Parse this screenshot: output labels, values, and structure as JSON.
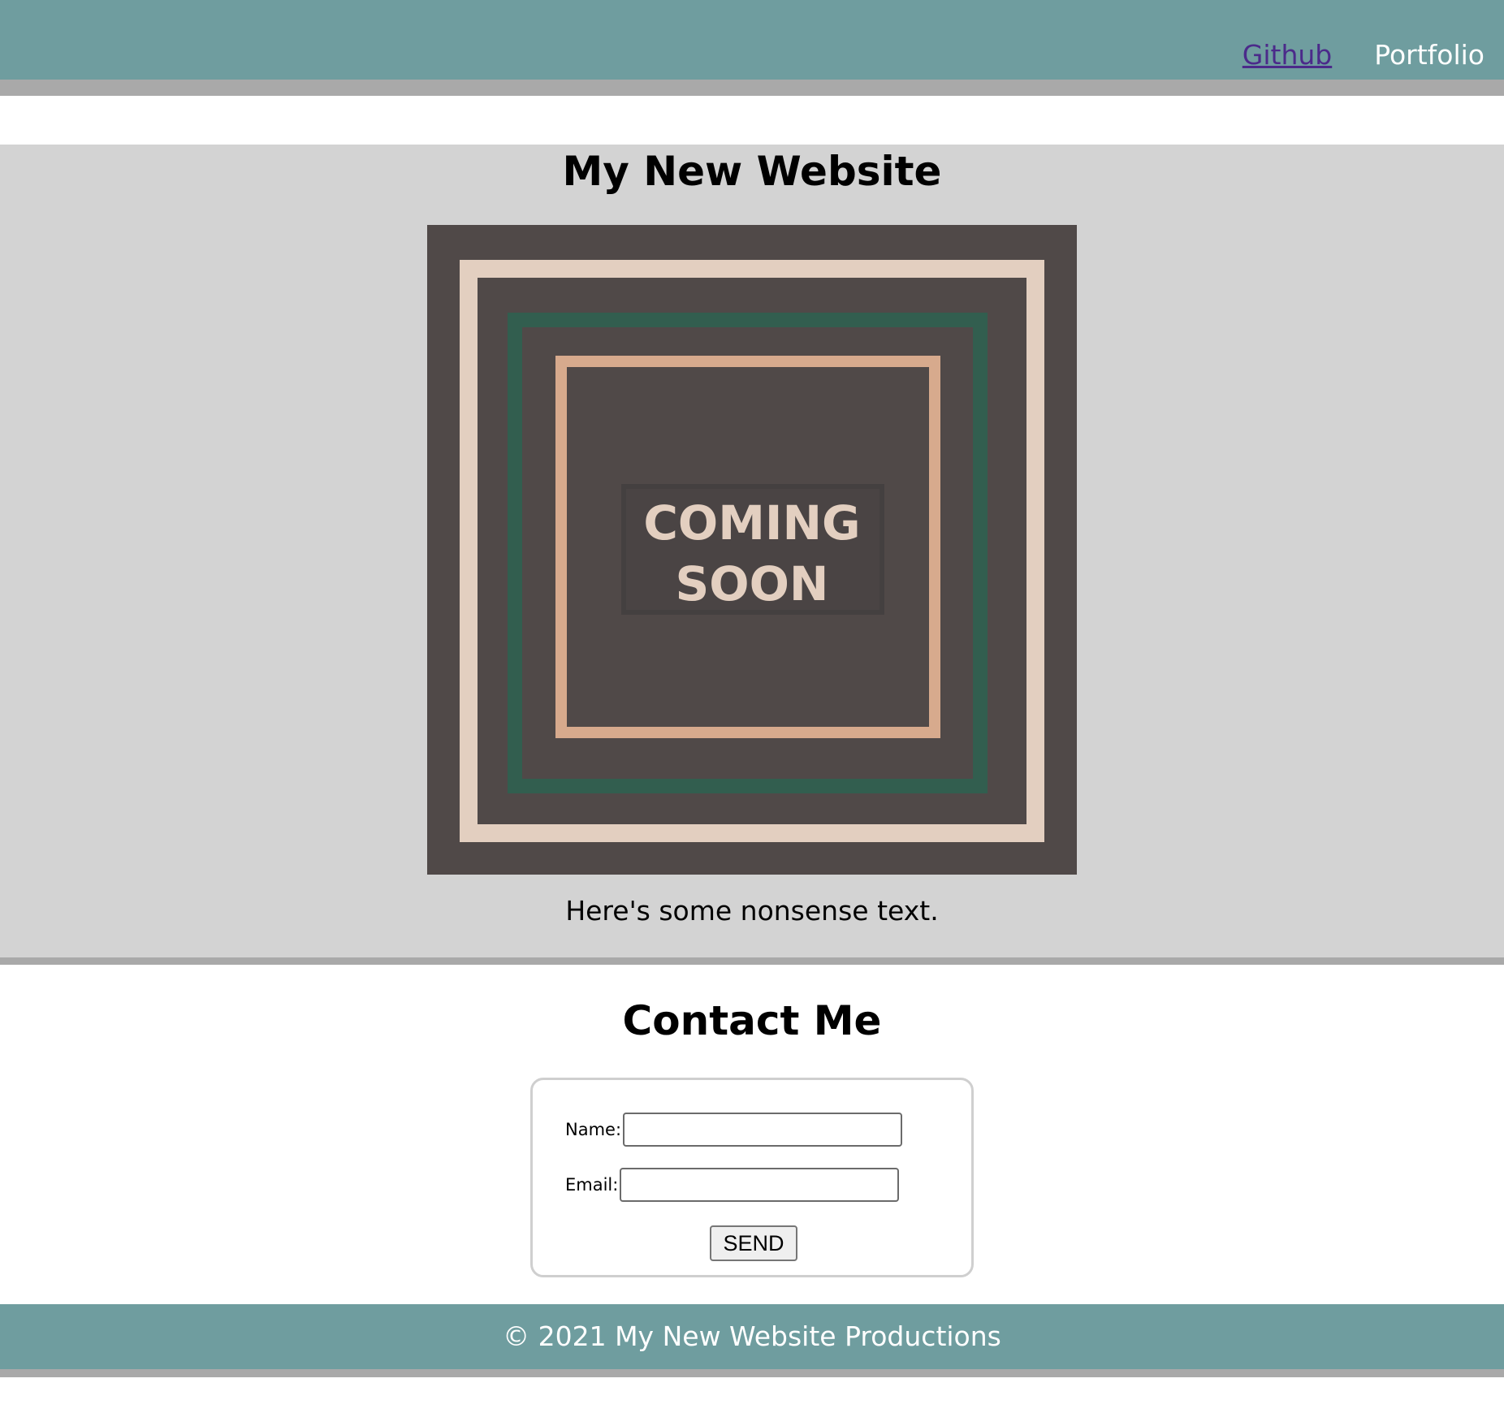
{
  "nav": {
    "links": [
      {
        "label": "Github",
        "visited": true
      },
      {
        "label": "Portfolio",
        "visited": false
      }
    ]
  },
  "main": {
    "title": "My New Website",
    "image_caption_line1": "COMING",
    "image_caption_line2": "SOON",
    "body_text": "Here's some nonsense text."
  },
  "contact": {
    "title": "Contact Me",
    "name_label": "Name:",
    "name_value": "",
    "email_label": "Email:",
    "email_value": "",
    "send_label": "SEND"
  },
  "footer": {
    "text": "© 2021 My New Website Productions"
  },
  "colors": {
    "header_bg": "#6f9d9f",
    "accent_border": "#a9a9a9",
    "main_bg": "#d3d3d3",
    "image_bg": "#504948",
    "frame_cream": "#e3cfc0",
    "frame_green": "#325e4f",
    "frame_peach": "#d7aa8d"
  }
}
